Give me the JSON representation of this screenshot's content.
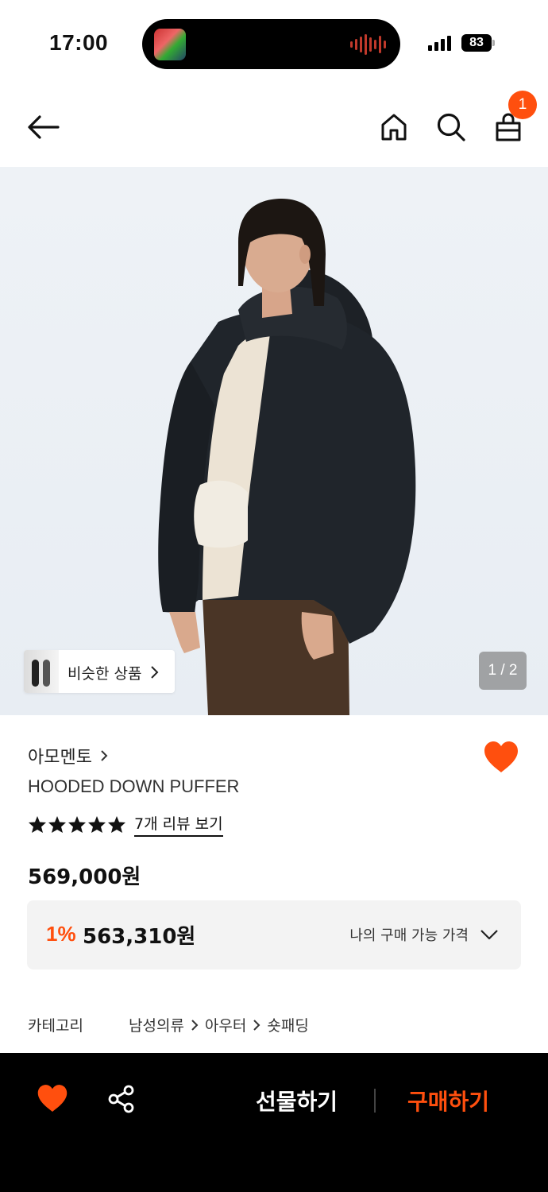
{
  "status_bar": {
    "time": "17:00",
    "battery": "83"
  },
  "nav": {
    "cart_count": "1"
  },
  "hero": {
    "similar_products_label": "비슷한 상품",
    "page_indicator": "1 / 2"
  },
  "product": {
    "brand": "아모멘토",
    "name": "HOODED DOWN PUFFER",
    "rating_stars": 5,
    "review_link": "7개 리뷰 보기",
    "price": "569,000원",
    "discount_rate": "1%",
    "discount_price": "563,310원",
    "my_price_label": "나의 구매 가능 가격",
    "category_label": "카테고리",
    "categories": [
      "남성의류",
      "아우터",
      "숏패딩"
    ]
  },
  "bottom_bar": {
    "gift_label": "선물하기",
    "buy_label": "구매하기"
  },
  "colors": {
    "accent": "#ff4f0e",
    "bottom_bar": "#000000",
    "price_box": "#f3f3f3"
  },
  "icons": [
    "back-arrow-icon",
    "home-icon",
    "search-icon",
    "cart-bag-icon",
    "chevron-right-icon",
    "heart-icon",
    "star-icon",
    "chevron-down-icon",
    "share-icon"
  ]
}
